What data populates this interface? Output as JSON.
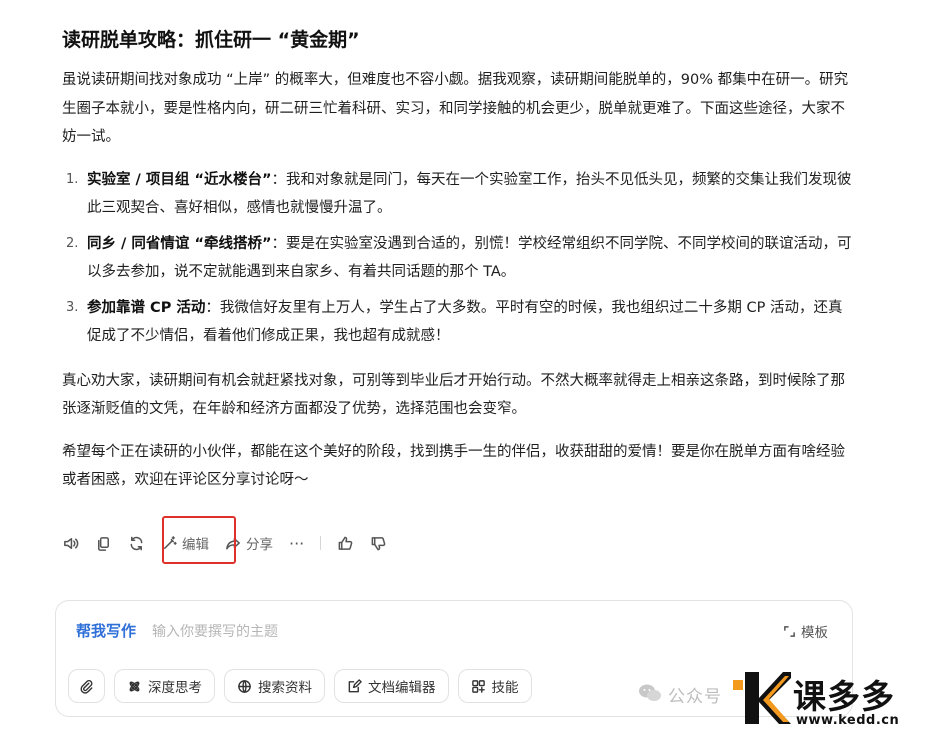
{
  "article": {
    "title": "读研脱单攻略：抓住研一 “黄金期”",
    "intro": "虽说读研期间找对象成功 “上岸” 的概率大，但难度也不容小觑。据我观察，读研期间能脱单的，90% 都集中在研一。研究生圈子本就小，要是性格内向，研二研三忙着科研、实习，和同学接触的机会更少，脱单就更难了。下面这些途径，大家不妨一试。",
    "steps": [
      {
        "num": "1.",
        "bold": "实验室 / 项目组 “近水楼台”",
        "text": "：我和对象就是同门，每天在一个实验室工作，抬头不见低头见，频繁的交集让我们发现彼此三观契合、喜好相似，感情也就慢慢升温了。"
      },
      {
        "num": "2.",
        "bold": "同乡 / 同省情谊 “牵线搭桥”",
        "text": "：要是在实验室没遇到合适的，别慌！学校经常组织不同学院、不同学校间的联谊活动，可以多去参加，说不定就能遇到来自家乡、有着共同话题的那个 TA。"
      },
      {
        "num": "3.",
        "bold": "参加靠谱 CP 活动",
        "text": "：我微信好友里有上万人，学生占了大多数。平时有空的时候，我也组织过二十多期 CP 活动，还真促成了不少情侣，看着他们修成正果，我也超有成就感！"
      }
    ],
    "advice": "真心劝大家，读研期间有机会就赶紧找对象，可别等到毕业后才开始行动。不然大概率就得走上相亲这条路，到时候除了那张逐渐贬值的文凭，在年龄和经济方面都没了优势，选择范围也会变窄。",
    "closing": "希望每个正在读研的小伙伴，都能在这个美好的阶段，找到携手一生的伴侣，收获甜甜的爱情！要是你在脱单方面有啥经验或者困惑，欢迎在评论区分享讨论呀～"
  },
  "actions": {
    "edit_label": "编辑",
    "share_label": "分享",
    "more_label": "···"
  },
  "composer": {
    "help_label": "帮我写作",
    "placeholder": "输入你要撰写的主题",
    "template_label": "模板",
    "tools": [
      {
        "label": "深度思考",
        "icon": "deep-think-icon"
      },
      {
        "label": "搜索资料",
        "icon": "globe-icon"
      },
      {
        "label": "文档编辑器",
        "icon": "document-edit-icon"
      },
      {
        "label": "技能",
        "icon": "grid-icon"
      }
    ]
  },
  "watermark": {
    "text": "公众号",
    "brand": "课多多",
    "url": "www.kedd.cn"
  },
  "colors": {
    "accent": "#2f6fd8",
    "highlight_border": "#e0302b"
  }
}
